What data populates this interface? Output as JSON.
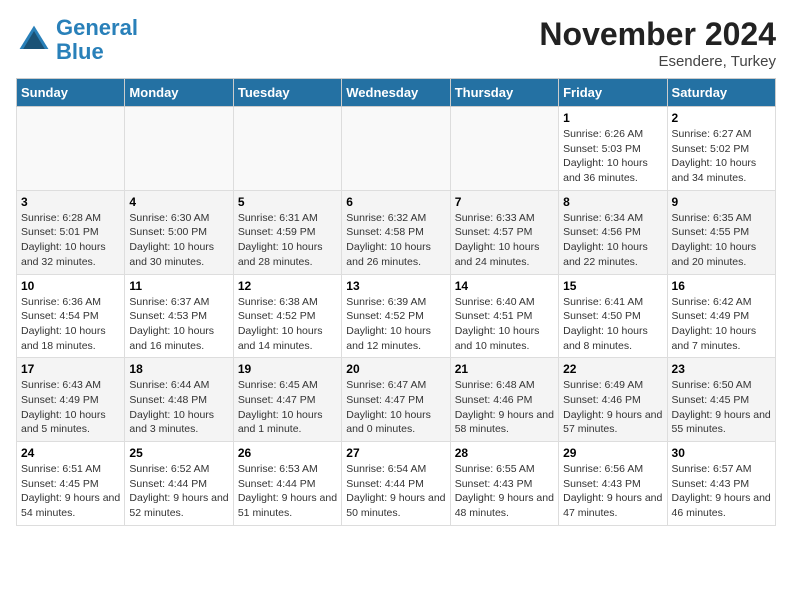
{
  "header": {
    "logo_general": "General",
    "logo_blue": "Blue",
    "month_title": "November 2024",
    "location": "Esendere, Turkey"
  },
  "days_of_week": [
    "Sunday",
    "Monday",
    "Tuesday",
    "Wednesday",
    "Thursday",
    "Friday",
    "Saturday"
  ],
  "weeks": [
    [
      {
        "day": "",
        "info": ""
      },
      {
        "day": "",
        "info": ""
      },
      {
        "day": "",
        "info": ""
      },
      {
        "day": "",
        "info": ""
      },
      {
        "day": "",
        "info": ""
      },
      {
        "day": "1",
        "info": "Sunrise: 6:26 AM\nSunset: 5:03 PM\nDaylight: 10 hours and 36 minutes."
      },
      {
        "day": "2",
        "info": "Sunrise: 6:27 AM\nSunset: 5:02 PM\nDaylight: 10 hours and 34 minutes."
      }
    ],
    [
      {
        "day": "3",
        "info": "Sunrise: 6:28 AM\nSunset: 5:01 PM\nDaylight: 10 hours and 32 minutes."
      },
      {
        "day": "4",
        "info": "Sunrise: 6:30 AM\nSunset: 5:00 PM\nDaylight: 10 hours and 30 minutes."
      },
      {
        "day": "5",
        "info": "Sunrise: 6:31 AM\nSunset: 4:59 PM\nDaylight: 10 hours and 28 minutes."
      },
      {
        "day": "6",
        "info": "Sunrise: 6:32 AM\nSunset: 4:58 PM\nDaylight: 10 hours and 26 minutes."
      },
      {
        "day": "7",
        "info": "Sunrise: 6:33 AM\nSunset: 4:57 PM\nDaylight: 10 hours and 24 minutes."
      },
      {
        "day": "8",
        "info": "Sunrise: 6:34 AM\nSunset: 4:56 PM\nDaylight: 10 hours and 22 minutes."
      },
      {
        "day": "9",
        "info": "Sunrise: 6:35 AM\nSunset: 4:55 PM\nDaylight: 10 hours and 20 minutes."
      }
    ],
    [
      {
        "day": "10",
        "info": "Sunrise: 6:36 AM\nSunset: 4:54 PM\nDaylight: 10 hours and 18 minutes."
      },
      {
        "day": "11",
        "info": "Sunrise: 6:37 AM\nSunset: 4:53 PM\nDaylight: 10 hours and 16 minutes."
      },
      {
        "day": "12",
        "info": "Sunrise: 6:38 AM\nSunset: 4:52 PM\nDaylight: 10 hours and 14 minutes."
      },
      {
        "day": "13",
        "info": "Sunrise: 6:39 AM\nSunset: 4:52 PM\nDaylight: 10 hours and 12 minutes."
      },
      {
        "day": "14",
        "info": "Sunrise: 6:40 AM\nSunset: 4:51 PM\nDaylight: 10 hours and 10 minutes."
      },
      {
        "day": "15",
        "info": "Sunrise: 6:41 AM\nSunset: 4:50 PM\nDaylight: 10 hours and 8 minutes."
      },
      {
        "day": "16",
        "info": "Sunrise: 6:42 AM\nSunset: 4:49 PM\nDaylight: 10 hours and 7 minutes."
      }
    ],
    [
      {
        "day": "17",
        "info": "Sunrise: 6:43 AM\nSunset: 4:49 PM\nDaylight: 10 hours and 5 minutes."
      },
      {
        "day": "18",
        "info": "Sunrise: 6:44 AM\nSunset: 4:48 PM\nDaylight: 10 hours and 3 minutes."
      },
      {
        "day": "19",
        "info": "Sunrise: 6:45 AM\nSunset: 4:47 PM\nDaylight: 10 hours and 1 minute."
      },
      {
        "day": "20",
        "info": "Sunrise: 6:47 AM\nSunset: 4:47 PM\nDaylight: 10 hours and 0 minutes."
      },
      {
        "day": "21",
        "info": "Sunrise: 6:48 AM\nSunset: 4:46 PM\nDaylight: 9 hours and 58 minutes."
      },
      {
        "day": "22",
        "info": "Sunrise: 6:49 AM\nSunset: 4:46 PM\nDaylight: 9 hours and 57 minutes."
      },
      {
        "day": "23",
        "info": "Sunrise: 6:50 AM\nSunset: 4:45 PM\nDaylight: 9 hours and 55 minutes."
      }
    ],
    [
      {
        "day": "24",
        "info": "Sunrise: 6:51 AM\nSunset: 4:45 PM\nDaylight: 9 hours and 54 minutes."
      },
      {
        "day": "25",
        "info": "Sunrise: 6:52 AM\nSunset: 4:44 PM\nDaylight: 9 hours and 52 minutes."
      },
      {
        "day": "26",
        "info": "Sunrise: 6:53 AM\nSunset: 4:44 PM\nDaylight: 9 hours and 51 minutes."
      },
      {
        "day": "27",
        "info": "Sunrise: 6:54 AM\nSunset: 4:44 PM\nDaylight: 9 hours and 50 minutes."
      },
      {
        "day": "28",
        "info": "Sunrise: 6:55 AM\nSunset: 4:43 PM\nDaylight: 9 hours and 48 minutes."
      },
      {
        "day": "29",
        "info": "Sunrise: 6:56 AM\nSunset: 4:43 PM\nDaylight: 9 hours and 47 minutes."
      },
      {
        "day": "30",
        "info": "Sunrise: 6:57 AM\nSunset: 4:43 PM\nDaylight: 9 hours and 46 minutes."
      }
    ]
  ]
}
